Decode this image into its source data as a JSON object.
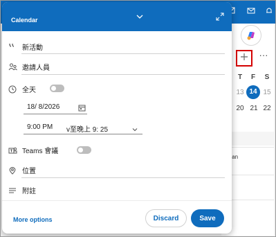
{
  "popup": {
    "header_title": "Calendar",
    "title_field": "新活動",
    "invitees": "邀請人員",
    "all_day_label": "全天",
    "date": "18/ 8/2026",
    "start_time": "9:00 PM",
    "end_time": "v至晚上 9: 25",
    "teams_label": "Teams 會議",
    "location": "位置",
    "notes": "附註",
    "more_options": "More options",
    "discard": "Discard",
    "save": "Save"
  },
  "calendar": {
    "day_headers": [
      "T",
      "F",
      "S"
    ],
    "row1": [
      "13",
      "14",
      "15"
    ],
    "row2": [
      "20",
      "21",
      "22"
    ],
    "snippet1": "njan",
    "snippet2": "t",
    "snippet3": "t"
  },
  "colors": {
    "accent": "#0f6cbd",
    "highlight": "#d40000"
  }
}
